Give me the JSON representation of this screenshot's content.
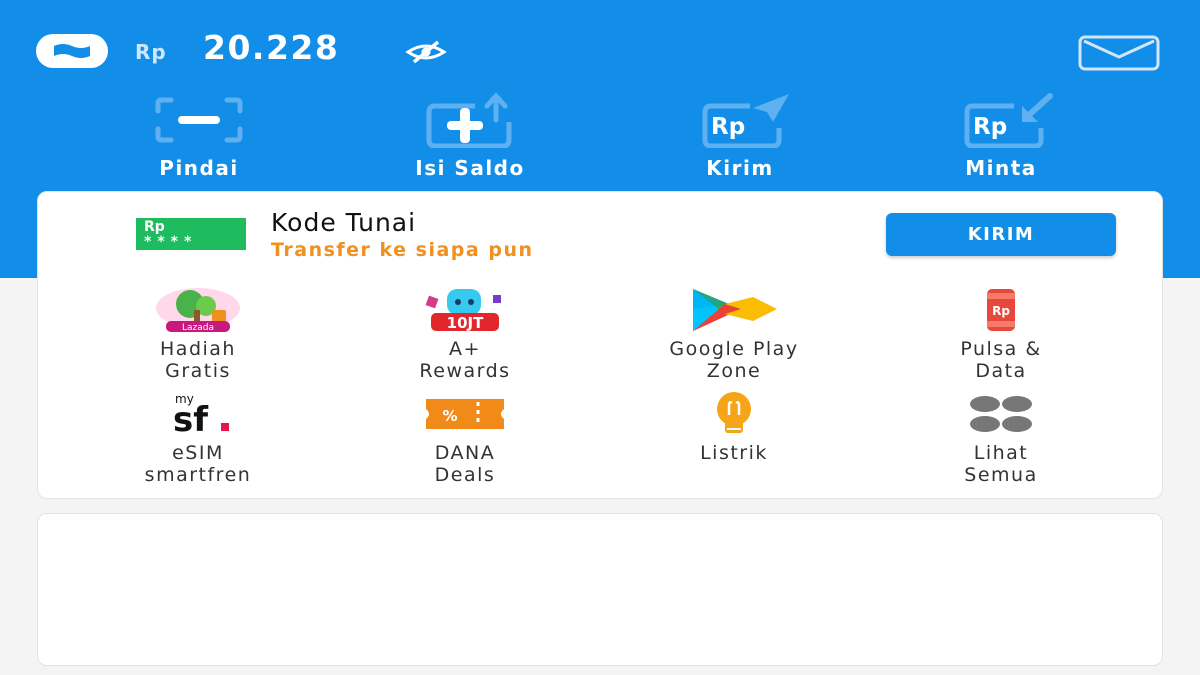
{
  "header": {
    "currency": "Rp",
    "balance": "20.228",
    "logo_icon": "dana-logo-icon",
    "visibility_icon": "eye-off-icon",
    "inbox_icon": "mail-icon",
    "bg_color": "#128ee9"
  },
  "actions": [
    {
      "label": "Pindai",
      "icon": "scan-icon"
    },
    {
      "label": "Isi Saldo",
      "icon": "top-up-icon"
    },
    {
      "label": "Kirim",
      "icon": "send-money-icon"
    },
    {
      "label": "Minta",
      "icon": "request-money-icon"
    }
  ],
  "kode_tunai": {
    "badge_currency": "Rp",
    "badge_mask": "****",
    "title": "Kode Tunai",
    "subtitle": "Transfer ke siapa pun",
    "button_label": "KIRIM",
    "subtitle_color": "#f0901e"
  },
  "services": [
    {
      "line1": "Hadiah",
      "line2": "Gratis",
      "icon": "lazada-gift-icon",
      "icon_text": "Lazada"
    },
    {
      "line1": "A+",
      "line2": "Rewards",
      "icon": "rewards-10jt-icon",
      "icon_text": "10JT"
    },
    {
      "line1": "Google Play",
      "line2": "Zone",
      "icon": "google-play-icon"
    },
    {
      "line1": "Pulsa &",
      "line2": "Data",
      "icon": "phone-credit-icon",
      "icon_text": "Rp"
    },
    {
      "line1": "eSIM",
      "line2": "smartfren",
      "icon": "smartfren-icon",
      "icon_text_top": "my",
      "icon_text": "sf"
    },
    {
      "line1": "DANA",
      "line2": "Deals",
      "icon": "deals-ticket-icon",
      "icon_text": "%"
    },
    {
      "line1": "Listrik",
      "line2": "",
      "icon": "lightbulb-icon"
    },
    {
      "line1": "Lihat",
      "line2": "Semua",
      "icon": "grid-more-icon"
    }
  ]
}
